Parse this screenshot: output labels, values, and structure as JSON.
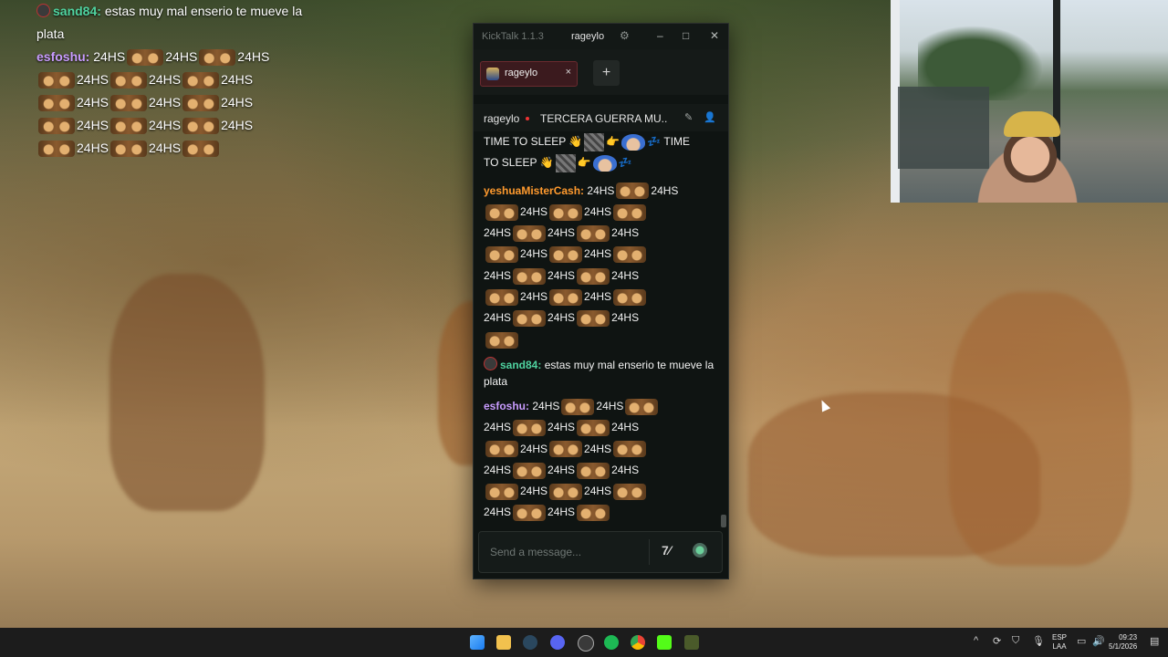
{
  "overlay": {
    "sand_name": "sand84:",
    "sand_msg_1": "estas muy mal enserio te mueve la",
    "sand_msg_2": "plata",
    "esfo_name": "esfoshu:",
    "token": "24HS"
  },
  "window": {
    "app_title": "KickTalk 1.1.3",
    "user": "rageylo",
    "gear_icon": "gear-icon",
    "minimize": "–",
    "maximize": "□",
    "close": "✕"
  },
  "tabs": [
    {
      "label": "rageylo",
      "close": "×"
    }
  ],
  "add_tab": "+",
  "stream": {
    "channel": "rageylo",
    "title": "TERCERA GUERRA MU...",
    "icon1": "✎",
    "icon2": "👤"
  },
  "chat": {
    "time_to_sleep": "TIME TO SLEEP",
    "time": "TIME",
    "to_sleep": "TO SLEEP",
    "yesh_name": "yeshuaMisterCash:",
    "token": "24HS",
    "sand_name": "sand84:",
    "sand_msg": "estas muy mal enserio te mueve la plata",
    "esfo_name": "esfoshu:"
  },
  "input": {
    "placeholder": "Send a message...",
    "btn_translate": "7⁄",
    "btn_emote": "emote-icon"
  },
  "taskbar": {
    "lang_1": "ESP",
    "lang_2": "LAA",
    "time": "09:23",
    "date": "5/1/2026",
    "chevron": "^"
  },
  "colors": {
    "accent_red": "#e33333",
    "username_green": "#4fd3a0",
    "username_purple": "#c99cff",
    "username_orange": "#ff9a2e"
  }
}
